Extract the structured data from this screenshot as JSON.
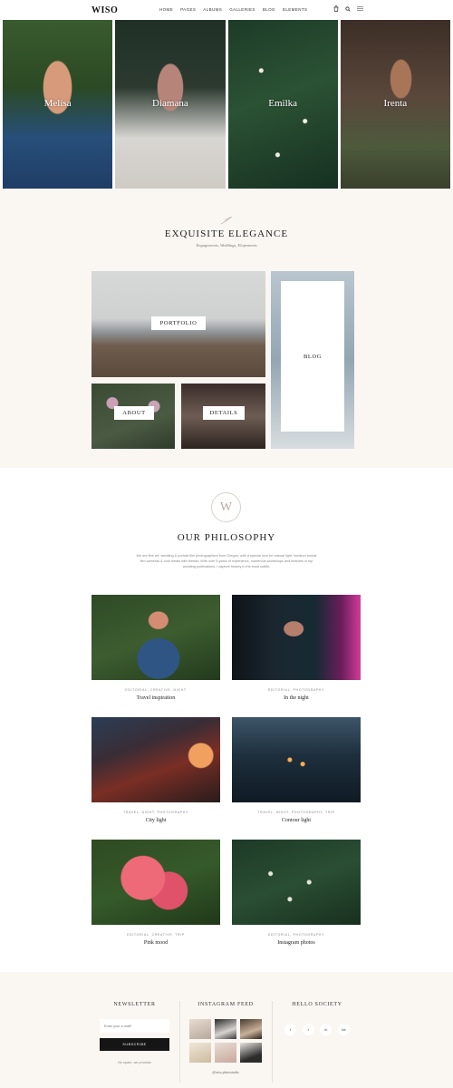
{
  "header": {
    "logo": "WISO",
    "nav": [
      "HOME",
      "PAGES",
      "ALBUMS",
      "GALLERIES",
      "BLOG",
      "ELEMENTS"
    ]
  },
  "hero": {
    "tiles": [
      {
        "name": "Melisa"
      },
      {
        "name": "Diamana"
      },
      {
        "name": "Emilka"
      },
      {
        "name": "Irenta"
      }
    ]
  },
  "elegance": {
    "title": "EXQUISITE ELEGANCE",
    "subtitle": "Engagements, Weddings, Elopements",
    "tiles": {
      "portfolio": "PORTFOLIO",
      "blog": "BLOG",
      "about": "ABOUT",
      "details": "DETAILS"
    }
  },
  "philosophy": {
    "logo_letter": "W",
    "title": "OUR PHILOSOPHY",
    "text": "We are fine art, wedding & portrait film photographers from Oregon, with a special love for natural light, medium format film cameras & cold meals with friends. With over 5 years of experience, numerous workshops and features in top wedding publications, I capture beauty in the most subtle."
  },
  "cards": [
    {
      "category": "EDITORIAL, CREATIVE, NIGHT",
      "title": "Travel inspiration"
    },
    {
      "category": "EDITORIAL, PHOTOGRAPHY",
      "title": "In the night"
    },
    {
      "category": "TRAVEL, NIGHT, PHOTOGRAPHY",
      "title": "City light"
    },
    {
      "category": "TRAVEL, NIGHT, PHOTOGRAPHY, TRIP",
      "title": "Contour light"
    },
    {
      "category": "EDITORIAL, CREATIVE, TRIP",
      "title": "Pink mood"
    },
    {
      "category": "EDITORIAL, PHOTOGRAPHY",
      "title": "Instagram photos"
    }
  ],
  "footer": {
    "newsletter": {
      "title": "NEWSLETTER",
      "placeholder": "Enter your e-mail*",
      "button": "SUBSCRIBE",
      "note": "No spam, we promise"
    },
    "instagram": {
      "title": "INSTAGRAM FEED",
      "handle": "@wiso.photostudio"
    },
    "social": {
      "title": "HELLO SOCIETY",
      "icons": [
        "f",
        "t",
        "in",
        "be"
      ]
    }
  }
}
